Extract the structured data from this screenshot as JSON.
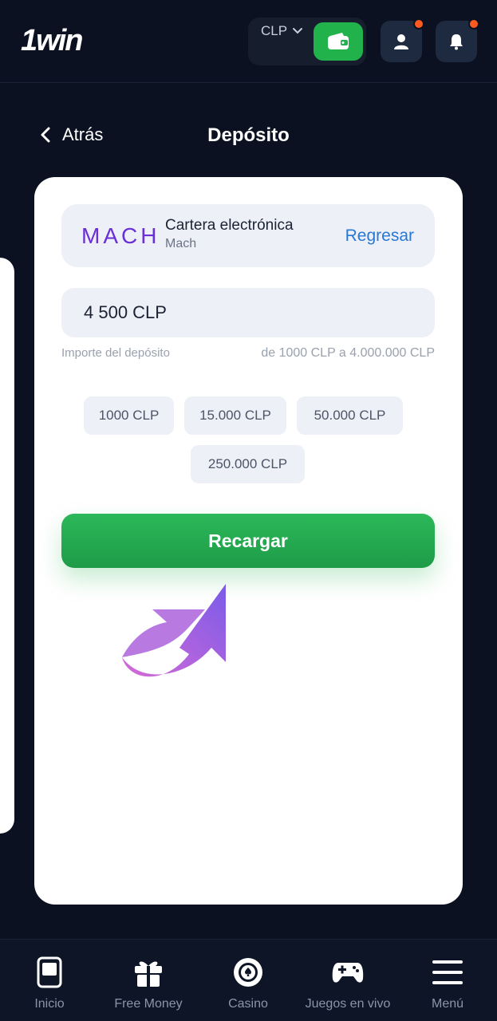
{
  "header": {
    "logo": "1win",
    "currency": "CLP"
  },
  "subheader": {
    "back_label": "Atrás",
    "title": "Depósito"
  },
  "method": {
    "logo_text": "MACH",
    "name": "Cartera electrónica",
    "sub": "Mach",
    "action": "Regresar"
  },
  "deposit": {
    "amount_value": "4 500 CLP",
    "amount_label": "Importe del depósito",
    "range": "de 1000 CLP a 4.000.000 CLP",
    "chips": [
      "1000 CLP",
      "15.000 CLP",
      "50.000 CLP",
      "250.000 CLP"
    ],
    "submit_label": "Recargar"
  },
  "nav": {
    "items": [
      {
        "label": "Inicio",
        "icon": "home-icon"
      },
      {
        "label": "Free Money",
        "icon": "gift-icon"
      },
      {
        "label": "Casino",
        "icon": "casino-chip-icon"
      },
      {
        "label": "Juegos en vivo",
        "icon": "gamepad-icon"
      },
      {
        "label": "Menú",
        "icon": "menu-icon"
      }
    ]
  },
  "colors": {
    "background": "#0b1120",
    "accent_green": "#22b24c",
    "link_blue": "#2878d8",
    "mach_purple": "#6a2fd6",
    "notification": "#ff5a1f"
  }
}
